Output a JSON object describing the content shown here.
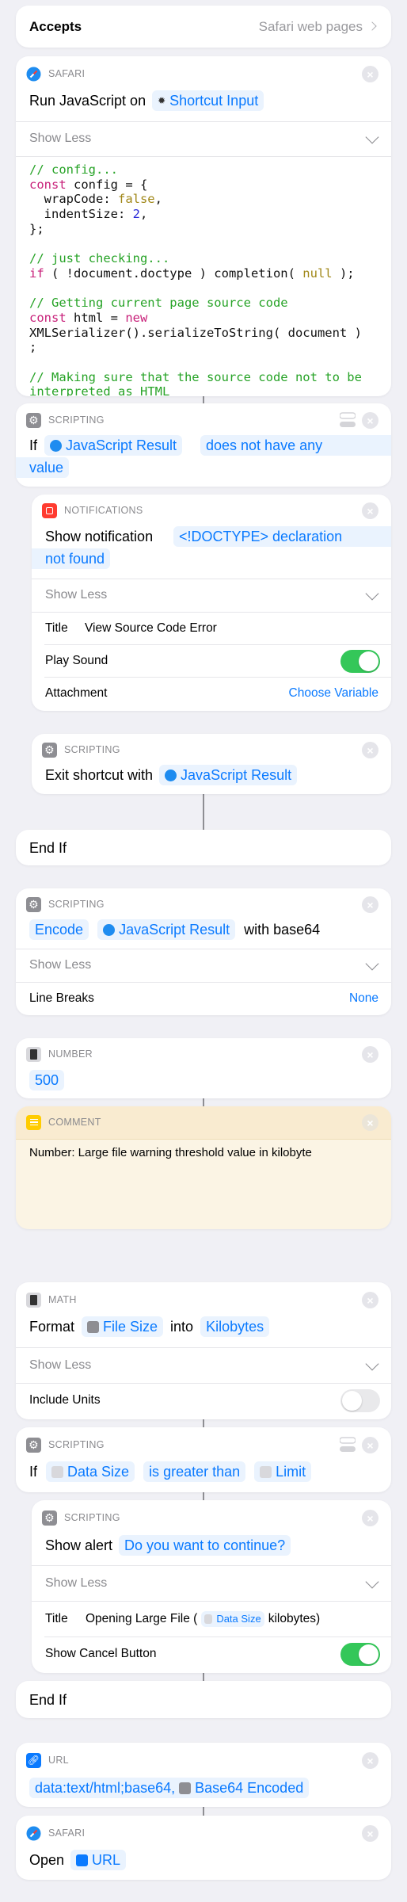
{
  "colors": {
    "accent": "#0a7aff",
    "toggle_on": "#34c759",
    "comment_bg": "#fbf4e4"
  },
  "accepts": {
    "label": "Accepts",
    "value": "Safari web pages"
  },
  "run_js": {
    "category": "SAFARI",
    "icon": "safari-icon",
    "text": "Run JavaScript on",
    "input": "Shortcut Input",
    "show_less": "Show Less",
    "code": [
      [
        [
          "c",
          "// config..."
        ]
      ],
      [
        [
          "k",
          "const"
        ],
        [
          "",
          "config = {"
        ]
      ],
      [
        [
          "",
          "  wrapCode: "
        ],
        [
          "o",
          "false"
        ],
        [
          "",
          ","
        ]
      ],
      [
        [
          "",
          "  indentSize: "
        ],
        [
          "n",
          "2"
        ],
        [
          "",
          ","
        ]
      ],
      [
        [
          "",
          "};"
        ]
      ],
      [
        [
          "",
          ""
        ]
      ],
      [
        [
          "c",
          "// just checking..."
        ]
      ],
      [
        [
          "k",
          "if"
        ],
        [
          "",
          " ( !document.doctype ) completion( "
        ],
        [
          "o",
          "null"
        ],
        [
          "",
          " );"
        ]
      ],
      [
        [
          "",
          ""
        ]
      ],
      [
        [
          "c",
          "// Getting current page source code"
        ]
      ],
      [
        [
          "k",
          "const"
        ],
        [
          "",
          " html = "
        ],
        [
          "k",
          "new"
        ]
      ],
      [
        [
          "",
          "XMLSerializer().serializeToString( document )"
        ]
      ],
      [
        [
          "",
          ";"
        ]
      ],
      [
        [
          "",
          ""
        ]
      ],
      [
        [
          "c",
          "// Making sure that the source code not to be"
        ]
      ],
      [
        [
          "c",
          "interpreted as HTML"
        ]
      ]
    ]
  },
  "if1": {
    "category": "SCRIPTING",
    "keyword": "If",
    "variable": "JavaScript Result",
    "condition_line1": "does not have any",
    "condition_line2": "value"
  },
  "notify": {
    "category": "NOTIFICATIONS",
    "text": "Show notification",
    "message_line1": "<!DOCTYPE> declaration",
    "message_line2": "not found",
    "show_less": "Show Less",
    "title_label": "Title",
    "title_value": "View Source Code Error",
    "play_sound_label": "Play Sound",
    "play_sound": true,
    "attachment_label": "Attachment",
    "attachment_value": "Choose Variable"
  },
  "exit": {
    "category": "SCRIPTING",
    "text": "Exit shortcut with",
    "variable": "JavaScript Result"
  },
  "endif1": {
    "label": "End If"
  },
  "encode": {
    "category": "SCRIPTING",
    "mode": "Encode",
    "variable": "JavaScript Result",
    "suffix": "with base64",
    "show_less": "Show Less",
    "line_breaks_label": "Line Breaks",
    "line_breaks_value": "None"
  },
  "number": {
    "category": "NUMBER",
    "value": "500"
  },
  "comment": {
    "category": "COMMENT",
    "text": "Number: Large file warning threshold value in kilobyte"
  },
  "math": {
    "category": "MATH",
    "text": "Format",
    "variable": "File Size",
    "into": "into",
    "unit": "Kilobytes",
    "show_less": "Show Less",
    "include_units_label": "Include Units",
    "include_units": false
  },
  "if2": {
    "category": "SCRIPTING",
    "keyword": "If",
    "variable": "Data Size",
    "condition": "is greater than",
    "compare": "Limit"
  },
  "alert": {
    "category": "SCRIPTING",
    "text": "Show alert",
    "message": "Do you want to continue?",
    "show_less": "Show Less",
    "title_label": "Title",
    "title_prefix": "Opening Large File (",
    "title_variable": "Data Size",
    "title_suffix": "kilobytes)",
    "cancel_label": "Show Cancel Button",
    "show_cancel": true
  },
  "endif2": {
    "label": "End If"
  },
  "url": {
    "category": "URL",
    "prefix": "data:text/html;base64,",
    "variable": "Base64 Encoded"
  },
  "open": {
    "category": "SAFARI",
    "text": "Open",
    "variable": "URL"
  }
}
